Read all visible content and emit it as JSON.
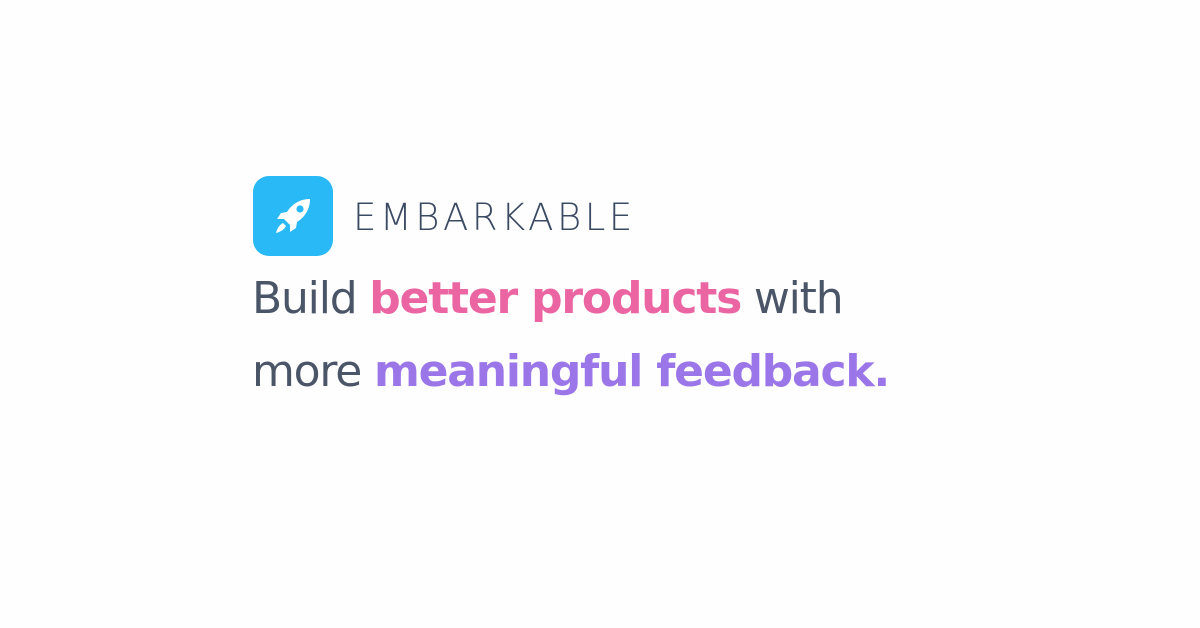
{
  "colors": {
    "background": "#fefefe",
    "logo_tile": "#29b9f6",
    "wordmark": "#3b4a63",
    "headline_text": "#4a5568",
    "accent_pink": "#ea65a1",
    "accent_purple": "#9b76e8"
  },
  "brand": {
    "icon": "rocket-icon",
    "name": "EMBARKABLE"
  },
  "headline": {
    "line1": {
      "lead": "Build ",
      "highlight": "better products",
      "trail": " with"
    },
    "line2": {
      "lead": "more ",
      "highlight": "meaningful feedback."
    }
  }
}
